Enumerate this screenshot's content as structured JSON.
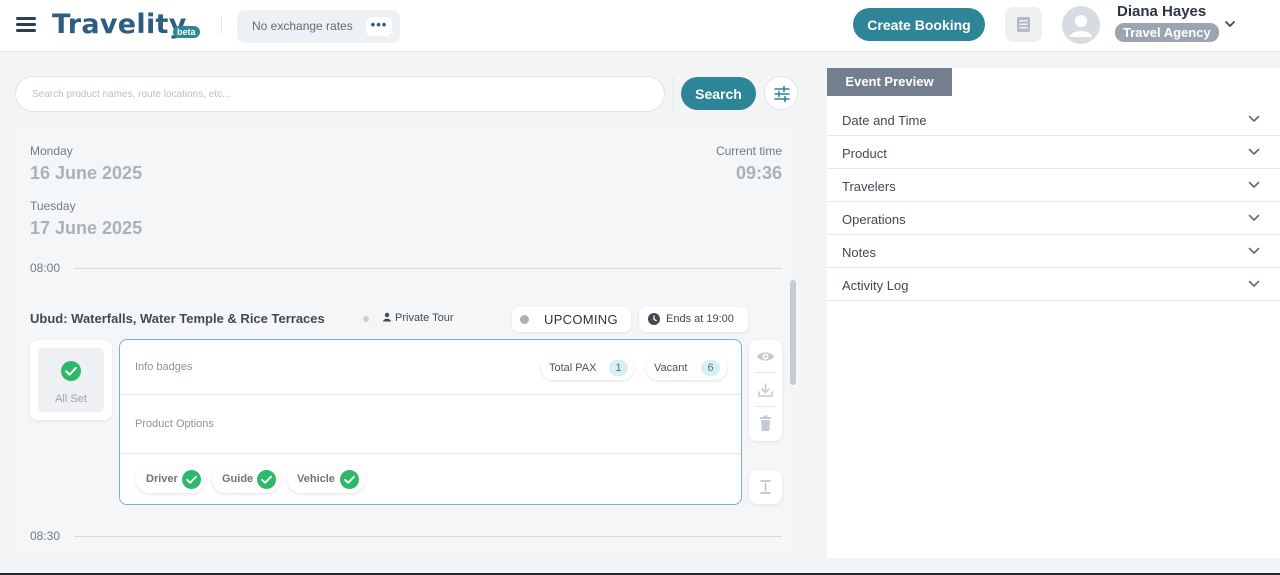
{
  "header": {
    "logo": "Travelity",
    "beta": "beta",
    "exchange_rates": "No exchange rates",
    "exchange_more": "•••",
    "create_booking": "Create Booking",
    "user": {
      "name": "Diana Hayes",
      "role": "Travel Agency"
    }
  },
  "search": {
    "placeholder": "Search product names, route locations, etc...",
    "value": "",
    "button": "Search"
  },
  "schedule": {
    "days": [
      {
        "weekday": "Monday",
        "date": "16 June 2025"
      },
      {
        "weekday": "Tuesday",
        "date": "17 June 2025"
      }
    ],
    "current_time_label": "Current time",
    "current_time": "09:36",
    "hours": [
      "08:00",
      "08:30"
    ],
    "event": {
      "title": "Ubud: Waterfalls, Water Temple & Rice Terraces",
      "tour_type": "Private Tour",
      "status": "UPCOMING",
      "ends": "Ends at 19:00",
      "all_set": "All Set",
      "info_badges_label": "Info badges",
      "badges": [
        {
          "label": "Total PAX",
          "count": "1"
        },
        {
          "label": "Vacant",
          "count": "6"
        }
      ],
      "product_options_label": "Product Options",
      "resources": [
        "Driver",
        "Guide",
        "Vehicle"
      ]
    }
  },
  "event_preview": {
    "tab": "Event Preview",
    "sections": [
      "Date and Time",
      "Product",
      "Travelers",
      "Operations",
      "Notes",
      "Activity Log"
    ]
  },
  "colors": {
    "primary": "#2d8597",
    "brand": "#2d5e82",
    "success": "#2eb86a",
    "muted": "#a8b2bd"
  },
  "icons": {
    "menu": "hamburger-icon",
    "notes": "document-icon",
    "avatar": "user-icon",
    "filter": "sliders-icon",
    "status": "dot-icon",
    "clock": "clock-icon",
    "check": "check-circle-icon",
    "view": "eye-icon",
    "download": "download-icon",
    "delete": "trash-icon",
    "expand": "expand-vertical-icon",
    "chevron": "chevron-down-icon"
  }
}
